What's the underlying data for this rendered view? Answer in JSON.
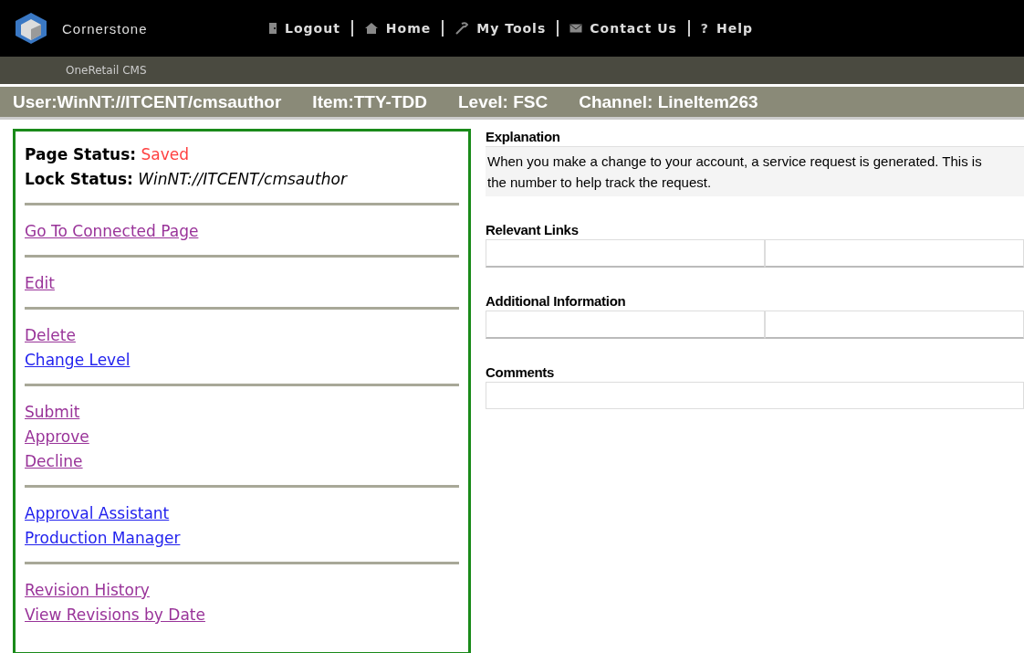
{
  "header": {
    "logo_text": "Cornerstone",
    "nav": [
      {
        "label": "Logout",
        "kind": "door"
      },
      {
        "label": "Home",
        "kind": "house"
      },
      {
        "label": "My Tools",
        "kind": "tool"
      },
      {
        "label": "Contact Us",
        "kind": "mail"
      },
      {
        "label": "Help",
        "kind": "help",
        "glyph": "?"
      }
    ]
  },
  "subheader": {
    "title": "OneRetail CMS"
  },
  "info_bar": [
    "User:WinNT://ITCENT/cmsauthor",
    "Item:TTY-TDD",
    "Level: FSC",
    "Channel: LineItem263"
  ],
  "sidebar": {
    "status": [
      {
        "label": "Page Status:",
        "value": "Saved",
        "kind": "alert"
      },
      {
        "label": "Lock Status:",
        "value": "WinNT://ITCENT/cmsauthor",
        "kind": "italic"
      }
    ],
    "groups": [
      [
        {
          "label": "Go To Connected Page",
          "visited": true
        }
      ],
      [
        {
          "label": "Edit",
          "visited": true
        }
      ],
      [
        {
          "label": "Delete",
          "visited": true
        },
        {
          "label": "Change Level",
          "visited": false
        }
      ],
      [
        {
          "label": "Submit",
          "visited": true
        },
        {
          "label": "Approve",
          "visited": true
        },
        {
          "label": "Decline",
          "visited": true
        }
      ],
      [
        {
          "label": "Approval Assistant",
          "visited": false
        },
        {
          "label": "Production Manager",
          "visited": false
        }
      ],
      [
        {
          "label": "Revision History",
          "visited": true
        },
        {
          "label": "View Revisions by Date",
          "visited": true
        }
      ]
    ]
  },
  "sections": [
    {
      "title": "Explanation",
      "kind": "text",
      "text": "When you make a change to your account, a service request is generated.  This is the number to help track the request."
    },
    {
      "title": "Relevant Links",
      "kind": "split"
    },
    {
      "title": "Additional Information",
      "kind": "split"
    },
    {
      "title": "Comments",
      "kind": "single"
    }
  ]
}
